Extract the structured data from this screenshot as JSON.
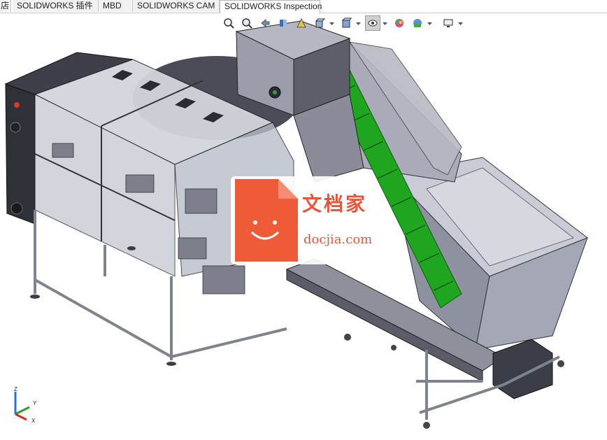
{
  "tabs": [
    {
      "label": "店",
      "active": false
    },
    {
      "label": "SOLIDWORKS 插件",
      "active": false
    },
    {
      "label": "MBD",
      "active": false
    },
    {
      "label": "SOLIDWORKS CAM",
      "active": false
    },
    {
      "label": "SOLIDWORKS Inspection",
      "active": true
    }
  ],
  "heads_up_toolbar": {
    "icons": [
      "zoom-to-fit-icon",
      "zoom-to-area-icon",
      "previous-view-icon",
      "section-view-icon",
      "dynamic-annotation-icon",
      "view-orientation-icon",
      "display-style-icon",
      "hide-show-items-icon",
      "edit-appearance-icon",
      "apply-scene-icon",
      "view-settings-icon"
    ]
  },
  "watermark": {
    "title": "文档家",
    "site": "docjia.com"
  },
  "triad": {
    "x": "X",
    "y": "Y",
    "z": "Z"
  },
  "colors": {
    "frame_grey": "#9a9ea8",
    "belt_green": "#1fa51f",
    "dark_panel": "#3c3f48",
    "hopper": "#a3a6b4",
    "watermark_orange": "#ef5a38"
  }
}
